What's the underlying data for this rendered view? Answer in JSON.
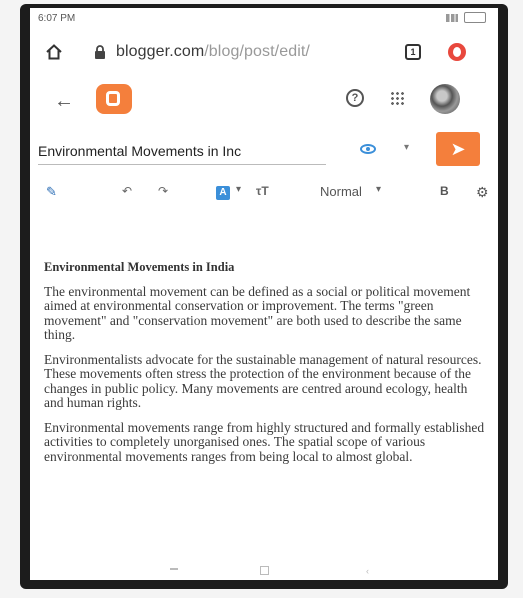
{
  "status_bar": {
    "time": "6:07 PM"
  },
  "browser": {
    "url_domain": "blogger.com",
    "url_path": "/blog/post/edit/",
    "tab_count": "1"
  },
  "blogger": {
    "post_title": "Environmental Movements in Inc",
    "publish_icon": "send-arrow-icon"
  },
  "toolbar": {
    "paragraph_style": "Normal",
    "bold_label": "B",
    "font_icon_label": "A"
  },
  "content": {
    "heading": "Environmental Movements in India",
    "paragraphs": [
      "The environmental movement can be defined as a social or political movement aimed at environmental conservation or improvement. The terms \"green movement\" and \"conservation movement\" are both used to describe the same thing.",
      "Environmentalists advocate for the sustainable management of natural resources. These movements often stress the protection of the environment because of the changes in public policy. Many movements are centred around ecology, health and human rights.",
      "Environmental movements range from highly structured and formally established activities to completely unorganised ones. The spatial scope of various environmental movements ranges from being local to almost global."
    ]
  },
  "colors": {
    "accent": "#f47f3c",
    "link_blue": "#3b8fd9"
  }
}
